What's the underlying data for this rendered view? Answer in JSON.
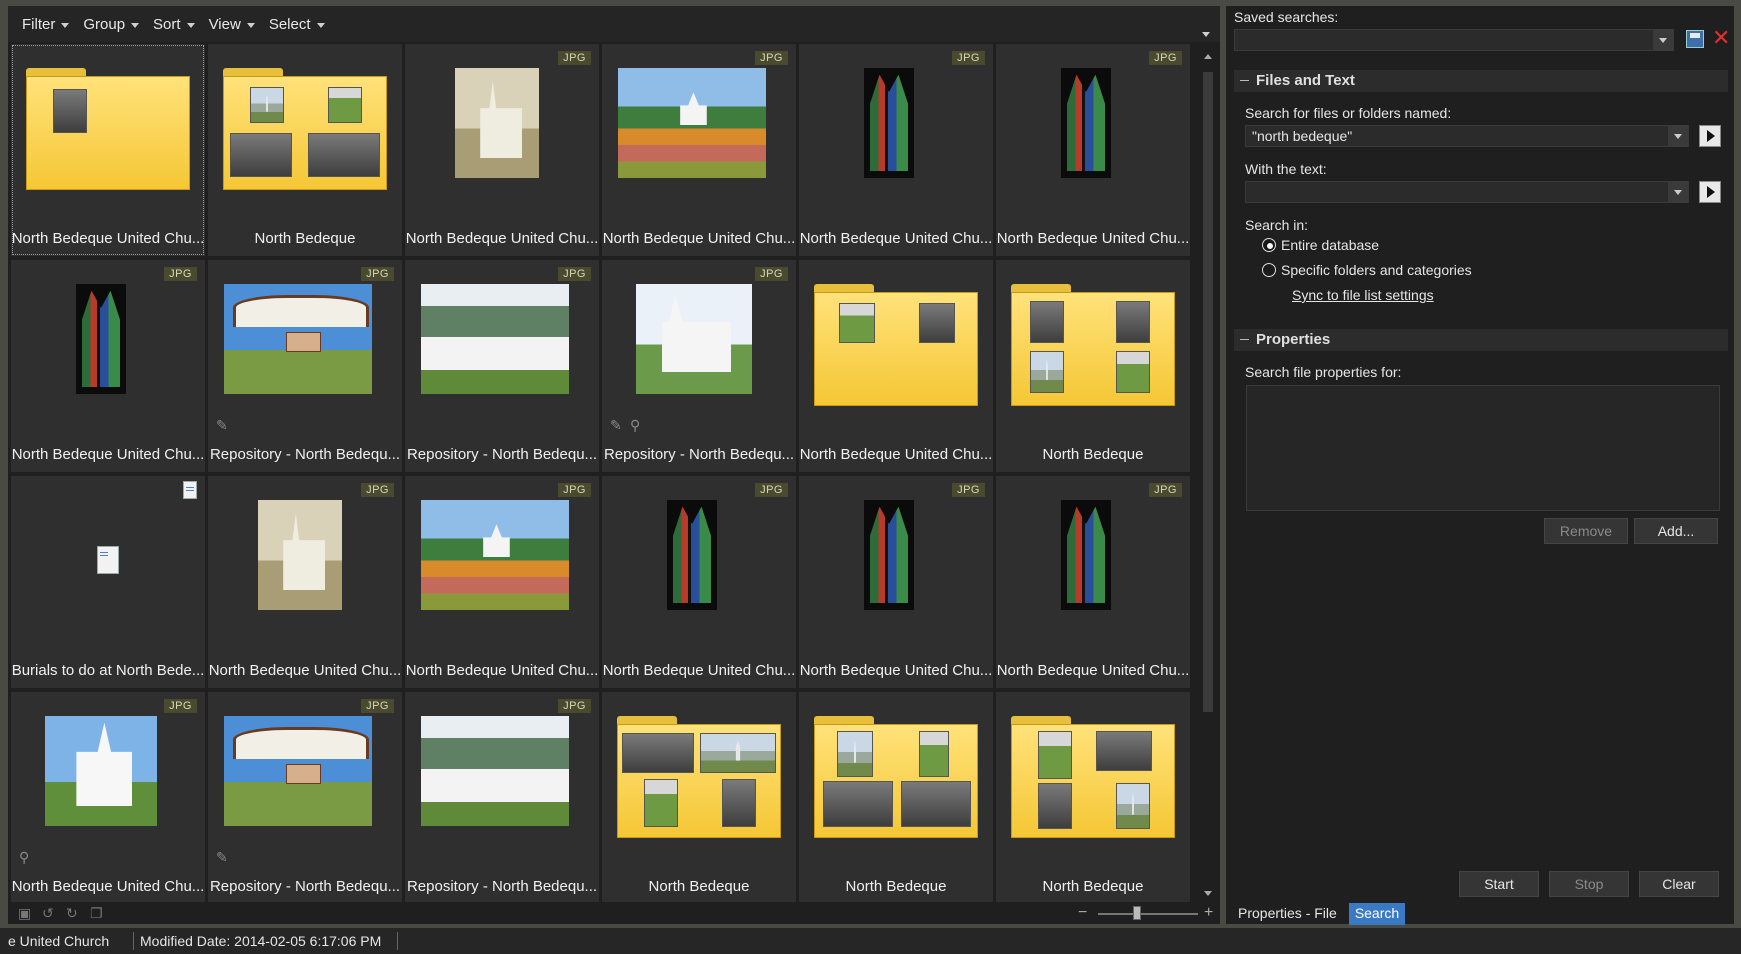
{
  "toolbar": {
    "menus": [
      {
        "label": "Filter"
      },
      {
        "label": "Group"
      },
      {
        "label": "Sort"
      },
      {
        "label": "View"
      },
      {
        "label": "Select"
      }
    ]
  },
  "tiles": [
    {
      "label": "North Bedeque United Chu...",
      "kind": "folder",
      "badge": ""
    },
    {
      "label": "North Bedeque",
      "kind": "folder",
      "badge": ""
    },
    {
      "label": "North Bedeque United Chu...",
      "kind": "sepia",
      "badge": "JPG"
    },
    {
      "label": "North Bedeque United Chu...",
      "kind": "autumn",
      "badge": "JPG"
    },
    {
      "label": "North Bedeque United Chu...",
      "kind": "glass",
      "badge": "JPG"
    },
    {
      "label": "North Bedeque United Chu...",
      "kind": "glass",
      "badge": "JPG"
    },
    {
      "label": "North Bedeque United Chu...",
      "kind": "glass",
      "badge": "JPG"
    },
    {
      "label": "Repository - North Bedequ...",
      "kind": "gate",
      "badge": "JPG"
    },
    {
      "label": "Repository - North Bedequ...",
      "kind": "white",
      "badge": "JPG"
    },
    {
      "label": "Repository - North Bedequ...",
      "kind": "white2",
      "badge": "JPG"
    },
    {
      "label": "North Bedeque United Chu...",
      "kind": "folder",
      "badge": ""
    },
    {
      "label": "North Bedeque",
      "kind": "folder",
      "badge": ""
    },
    {
      "label": "Burials to do at North Bede...",
      "kind": "doc",
      "badge": ""
    },
    {
      "label": "North Bedeque United Chu...",
      "kind": "sepia",
      "badge": "JPG"
    },
    {
      "label": "North Bedeque United Chu...",
      "kind": "autumn",
      "badge": "JPG"
    },
    {
      "label": "North Bedeque United Chu...",
      "kind": "glass",
      "badge": "JPG"
    },
    {
      "label": "North Bedeque United Chu...",
      "kind": "glass",
      "badge": "JPG"
    },
    {
      "label": "North Bedeque United Chu...",
      "kind": "glass",
      "badge": "JPG"
    },
    {
      "label": "North Bedeque United Chu...",
      "kind": "blue",
      "badge": "JPG"
    },
    {
      "label": "Repository - North Bedequ...",
      "kind": "gate",
      "badge": "JPG"
    },
    {
      "label": "Repository - North Bedequ...",
      "kind": "white",
      "badge": "JPG"
    },
    {
      "label": "North Bedeque",
      "kind": "folder",
      "badge": ""
    },
    {
      "label": "North Bedeque",
      "kind": "folder",
      "badge": ""
    },
    {
      "label": "North Bedeque",
      "kind": "folder",
      "badge": ""
    }
  ],
  "search": {
    "saved_searches_label": "Saved searches:",
    "saved_searches_value": "",
    "files_and_text_header": "Files and Text",
    "files_named_label": "Search for files or folders named:",
    "files_named_value": "\"north bedeque\"",
    "with_text_label": "With the text:",
    "with_text_value": "",
    "search_in_label": "Search in:",
    "entire_database_label": "Entire database",
    "specific_folders_label": "Specific folders and categories",
    "sync_link": "Sync to file list settings",
    "properties_header": "Properties",
    "search_props_label": "Search file properties for:",
    "remove_label": "Remove",
    "add_label": "Add...",
    "start_label": "Start",
    "stop_label": "Stop",
    "clear_label": "Clear"
  },
  "bottom_tabs": [
    {
      "label": "Properties - File",
      "active": false
    },
    {
      "label": "Search",
      "active": true
    }
  ],
  "status": {
    "left_text": "e United Church",
    "modified": "Modified Date: 2014-02-05 6:17:06 PM"
  },
  "colors": {
    "accent": "#3a7ac4",
    "folder_yellow": "#f5c735",
    "close_red": "#e03030"
  }
}
